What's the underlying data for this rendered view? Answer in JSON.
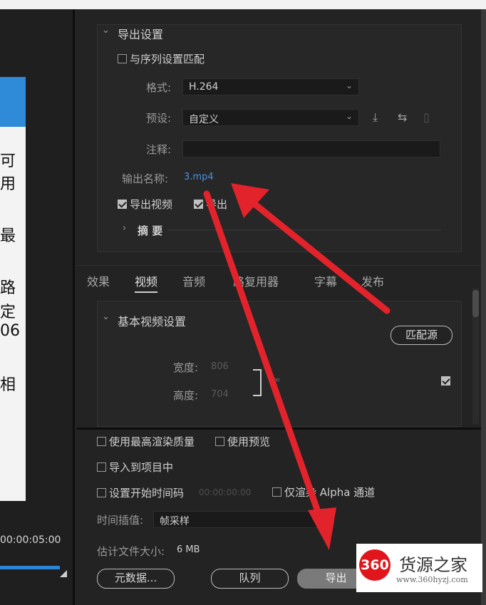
{
  "left_panel": {
    "dialog_chars": [
      "可",
      "用",
      "最",
      "路",
      "定",
      "06",
      "相"
    ],
    "timecode": "00:00:05:00"
  },
  "export_settings": {
    "section_title": "导出设置",
    "match_sequence_label": "与序列设置匹配",
    "match_sequence_checked": false,
    "format_label": "格式:",
    "format_value": "H.264",
    "preset_label": "预设:",
    "preset_value": "自定义",
    "comment_label": "注释:",
    "comment_value": "",
    "output_name_label": "输出名称:",
    "output_name_value": "3.mp4",
    "export_video_label": "导出视频",
    "export_video_checked": true,
    "export_audio_label": "导出",
    "export_audio_checked": true,
    "summary_label": "摘 要"
  },
  "tabs": [
    {
      "label": "效果",
      "active": false
    },
    {
      "label": "视频",
      "active": true
    },
    {
      "label": "音频",
      "active": false
    },
    {
      "label": "路复用器",
      "active": false
    },
    {
      "label": "字幕",
      "active": false
    },
    {
      "label": "发布",
      "active": false
    }
  ],
  "video_settings": {
    "section_title": "基本视频设置",
    "match_source_button": "匹配源",
    "width_label": "宽度:",
    "width_value": "806",
    "height_label": "高度:",
    "height_value": "704",
    "checkbox_checked": true
  },
  "bottom": {
    "max_render_label": "使用最高渲染质量",
    "use_preview_label": "使用预览",
    "import_project_label": "导入到项目中",
    "set_start_tc_label": "设置开始时间码",
    "start_tc_value": "00:00:00:00",
    "alpha_only_label": "仅渲染 Alpha 通道",
    "time_interp_label": "时间插值:",
    "time_interp_value": "帧采样",
    "est_size_label": "估计文件大小:",
    "est_size_value": "6 MB",
    "metadata_button": "元数据...",
    "queue_button": "队列",
    "export_button": "导出"
  },
  "watermark": {
    "badge": "360",
    "title": "货源之家",
    "url": "www.360hyzj.com"
  },
  "colors": {
    "accent_blue": "#2c86d5",
    "link_blue": "#4a90e2",
    "annotation_red": "#e3232b"
  }
}
